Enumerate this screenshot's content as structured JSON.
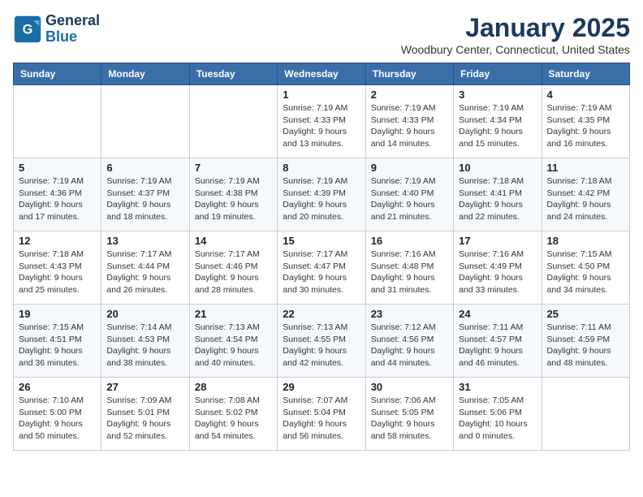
{
  "header": {
    "logo_line1": "General",
    "logo_line2": "Blue",
    "title": "January 2025",
    "subtitle": "Woodbury Center, Connecticut, United States"
  },
  "days_of_week": [
    "Sunday",
    "Monday",
    "Tuesday",
    "Wednesday",
    "Thursday",
    "Friday",
    "Saturday"
  ],
  "weeks": [
    [
      {
        "day": null,
        "info": null
      },
      {
        "day": null,
        "info": null
      },
      {
        "day": null,
        "info": null
      },
      {
        "day": "1",
        "info": "Sunrise: 7:19 AM\nSunset: 4:33 PM\nDaylight: 9 hours and 13 minutes."
      },
      {
        "day": "2",
        "info": "Sunrise: 7:19 AM\nSunset: 4:33 PM\nDaylight: 9 hours and 14 minutes."
      },
      {
        "day": "3",
        "info": "Sunrise: 7:19 AM\nSunset: 4:34 PM\nDaylight: 9 hours and 15 minutes."
      },
      {
        "day": "4",
        "info": "Sunrise: 7:19 AM\nSunset: 4:35 PM\nDaylight: 9 hours and 16 minutes."
      }
    ],
    [
      {
        "day": "5",
        "info": "Sunrise: 7:19 AM\nSunset: 4:36 PM\nDaylight: 9 hours and 17 minutes."
      },
      {
        "day": "6",
        "info": "Sunrise: 7:19 AM\nSunset: 4:37 PM\nDaylight: 9 hours and 18 minutes."
      },
      {
        "day": "7",
        "info": "Sunrise: 7:19 AM\nSunset: 4:38 PM\nDaylight: 9 hours and 19 minutes."
      },
      {
        "day": "8",
        "info": "Sunrise: 7:19 AM\nSunset: 4:39 PM\nDaylight: 9 hours and 20 minutes."
      },
      {
        "day": "9",
        "info": "Sunrise: 7:19 AM\nSunset: 4:40 PM\nDaylight: 9 hours and 21 minutes."
      },
      {
        "day": "10",
        "info": "Sunrise: 7:18 AM\nSunset: 4:41 PM\nDaylight: 9 hours and 22 minutes."
      },
      {
        "day": "11",
        "info": "Sunrise: 7:18 AM\nSunset: 4:42 PM\nDaylight: 9 hours and 24 minutes."
      }
    ],
    [
      {
        "day": "12",
        "info": "Sunrise: 7:18 AM\nSunset: 4:43 PM\nDaylight: 9 hours and 25 minutes."
      },
      {
        "day": "13",
        "info": "Sunrise: 7:17 AM\nSunset: 4:44 PM\nDaylight: 9 hours and 26 minutes."
      },
      {
        "day": "14",
        "info": "Sunrise: 7:17 AM\nSunset: 4:46 PM\nDaylight: 9 hours and 28 minutes."
      },
      {
        "day": "15",
        "info": "Sunrise: 7:17 AM\nSunset: 4:47 PM\nDaylight: 9 hours and 30 minutes."
      },
      {
        "day": "16",
        "info": "Sunrise: 7:16 AM\nSunset: 4:48 PM\nDaylight: 9 hours and 31 minutes."
      },
      {
        "day": "17",
        "info": "Sunrise: 7:16 AM\nSunset: 4:49 PM\nDaylight: 9 hours and 33 minutes."
      },
      {
        "day": "18",
        "info": "Sunrise: 7:15 AM\nSunset: 4:50 PM\nDaylight: 9 hours and 34 minutes."
      }
    ],
    [
      {
        "day": "19",
        "info": "Sunrise: 7:15 AM\nSunset: 4:51 PM\nDaylight: 9 hours and 36 minutes."
      },
      {
        "day": "20",
        "info": "Sunrise: 7:14 AM\nSunset: 4:53 PM\nDaylight: 9 hours and 38 minutes."
      },
      {
        "day": "21",
        "info": "Sunrise: 7:13 AM\nSunset: 4:54 PM\nDaylight: 9 hours and 40 minutes."
      },
      {
        "day": "22",
        "info": "Sunrise: 7:13 AM\nSunset: 4:55 PM\nDaylight: 9 hours and 42 minutes."
      },
      {
        "day": "23",
        "info": "Sunrise: 7:12 AM\nSunset: 4:56 PM\nDaylight: 9 hours and 44 minutes."
      },
      {
        "day": "24",
        "info": "Sunrise: 7:11 AM\nSunset: 4:57 PM\nDaylight: 9 hours and 46 minutes."
      },
      {
        "day": "25",
        "info": "Sunrise: 7:11 AM\nSunset: 4:59 PM\nDaylight: 9 hours and 48 minutes."
      }
    ],
    [
      {
        "day": "26",
        "info": "Sunrise: 7:10 AM\nSunset: 5:00 PM\nDaylight: 9 hours and 50 minutes."
      },
      {
        "day": "27",
        "info": "Sunrise: 7:09 AM\nSunset: 5:01 PM\nDaylight: 9 hours and 52 minutes."
      },
      {
        "day": "28",
        "info": "Sunrise: 7:08 AM\nSunset: 5:02 PM\nDaylight: 9 hours and 54 minutes."
      },
      {
        "day": "29",
        "info": "Sunrise: 7:07 AM\nSunset: 5:04 PM\nDaylight: 9 hours and 56 minutes."
      },
      {
        "day": "30",
        "info": "Sunrise: 7:06 AM\nSunset: 5:05 PM\nDaylight: 9 hours and 58 minutes."
      },
      {
        "day": "31",
        "info": "Sunrise: 7:05 AM\nSunset: 5:06 PM\nDaylight: 10 hours and 0 minutes."
      },
      {
        "day": null,
        "info": null
      }
    ]
  ]
}
